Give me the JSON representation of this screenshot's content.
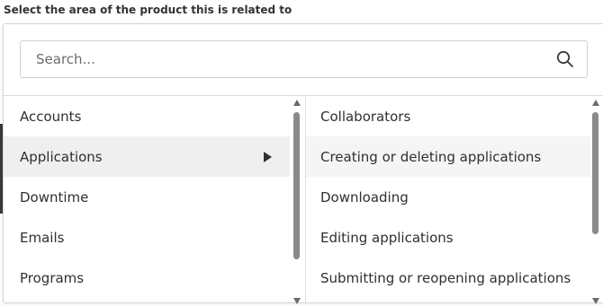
{
  "heading": "Select the area of the product this is related to",
  "search": {
    "placeholder": "Search...",
    "value": ""
  },
  "categories": [
    {
      "label": "Accounts"
    },
    {
      "label": "Applications"
    },
    {
      "label": "Downtime"
    },
    {
      "label": "Emails"
    },
    {
      "label": "Programs"
    }
  ],
  "selected_category": "Applications",
  "subcategories": [
    {
      "label": "Collaborators"
    },
    {
      "label": "Creating or deleting applications"
    },
    {
      "label": "Downloading"
    },
    {
      "label": "Editing applications"
    },
    {
      "label": "Submitting or reopening applications"
    }
  ],
  "icons": {
    "search": "search-icon",
    "expand": "caret-right-icon"
  }
}
